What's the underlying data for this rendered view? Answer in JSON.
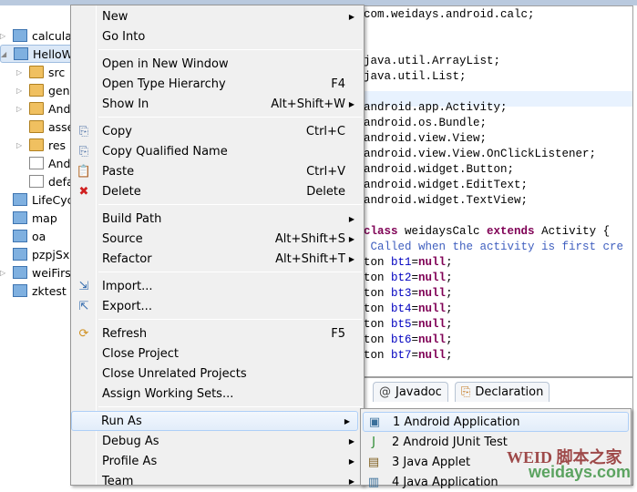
{
  "explorer": {
    "items": [
      {
        "label": "calculat",
        "kind": "proj",
        "tw": true,
        "indent": 0
      },
      {
        "label": "HelloW",
        "kind": "proj",
        "tw": true,
        "indent": 0,
        "selected": true
      },
      {
        "label": "src",
        "kind": "folder",
        "tw": true,
        "indent": 1
      },
      {
        "label": "gen",
        "kind": "folder",
        "tw": true,
        "indent": 1
      },
      {
        "label": "And",
        "kind": "lib",
        "tw": true,
        "indent": 1
      },
      {
        "label": "asse",
        "kind": "folder",
        "tw": false,
        "indent": 1
      },
      {
        "label": "res",
        "kind": "folder",
        "tw": true,
        "indent": 1
      },
      {
        "label": "And",
        "kind": "file",
        "tw": false,
        "indent": 1
      },
      {
        "label": "defa",
        "kind": "file",
        "tw": false,
        "indent": 1
      },
      {
        "label": "LifeCycl",
        "kind": "closed",
        "tw": false,
        "indent": 0
      },
      {
        "label": "map",
        "kind": "closed",
        "tw": false,
        "indent": 0
      },
      {
        "label": "oa",
        "kind": "closed",
        "tw": false,
        "indent": 0
      },
      {
        "label": "pzpjSx",
        "kind": "closed",
        "tw": false,
        "indent": 0
      },
      {
        "label": "weiFirst",
        "kind": "proj",
        "tw": true,
        "indent": 0
      },
      {
        "label": "zktest",
        "kind": "closed",
        "tw": false,
        "indent": 0
      }
    ]
  },
  "editor": {
    "lines": [
      [
        [
          "",
          "com.weidays.android.calc;"
        ]
      ],
      [],
      [],
      [
        [
          "",
          "java.util.ArrayList;"
        ]
      ],
      [
        [
          "",
          "java.util.List;"
        ]
      ],
      [],
      [
        [
          "",
          "android.app.Activity;"
        ]
      ],
      [
        [
          "",
          "android.os.Bundle;"
        ]
      ],
      [
        [
          "",
          "android.view.View;"
        ]
      ],
      [
        [
          "",
          "android.view.View.OnClickListener;"
        ]
      ],
      [
        [
          "",
          "android.widget.Button;"
        ]
      ],
      [
        [
          "",
          "android.widget.EditText;"
        ]
      ],
      [
        [
          "",
          "android.widget.TextView;"
        ]
      ],
      [],
      [
        [
          "kw",
          "class"
        ],
        [
          "",
          " weidaysCalc "
        ],
        [
          "kw",
          "extends"
        ],
        [
          "",
          " Activity {"
        ]
      ],
      [
        [
          "cm",
          " Called when the activity is first cre"
        ]
      ],
      [
        [
          "",
          "ton "
        ],
        [
          "fld",
          "bt1"
        ],
        [
          "",
          "="
        ],
        [
          "kw",
          "null"
        ],
        [
          "",
          ";"
        ]
      ],
      [
        [
          "",
          "ton "
        ],
        [
          "fld",
          "bt2"
        ],
        [
          "",
          "="
        ],
        [
          "kw",
          "null"
        ],
        [
          "",
          ";"
        ]
      ],
      [
        [
          "",
          "ton "
        ],
        [
          "fld",
          "bt3"
        ],
        [
          "",
          "="
        ],
        [
          "kw",
          "null"
        ],
        [
          "",
          ";"
        ]
      ],
      [
        [
          "",
          "ton "
        ],
        [
          "fld",
          "bt4"
        ],
        [
          "",
          "="
        ],
        [
          "kw",
          "null"
        ],
        [
          "",
          ";"
        ]
      ],
      [
        [
          "",
          "ton "
        ],
        [
          "fld",
          "bt5"
        ],
        [
          "",
          "="
        ],
        [
          "kw",
          "null"
        ],
        [
          "",
          ";"
        ]
      ],
      [
        [
          "",
          "ton "
        ],
        [
          "fld",
          "bt6"
        ],
        [
          "",
          "="
        ],
        [
          "kw",
          "null"
        ],
        [
          "",
          ";"
        ]
      ],
      [
        [
          "",
          "ton "
        ],
        [
          "fld",
          "bt7"
        ],
        [
          "",
          "="
        ],
        [
          "kw",
          "null"
        ],
        [
          "",
          ";"
        ]
      ]
    ]
  },
  "bottom": {
    "tabs": [
      {
        "label": "Javadoc",
        "icon": "@"
      },
      {
        "label": "Declaration",
        "icon": "declaration-icon"
      }
    ]
  },
  "menu": {
    "groups": [
      [
        {
          "label": "New",
          "arrow": true
        },
        {
          "label": "Go Into"
        }
      ],
      [
        {
          "label": "Open in New Window"
        },
        {
          "label": "Open Type Hierarchy",
          "shortcut": "F4"
        },
        {
          "label": "Show In",
          "shortcut": "Alt+Shift+W",
          "arrow": true
        }
      ],
      [
        {
          "label": "Copy",
          "shortcut": "Ctrl+C",
          "icon": "copy-icon"
        },
        {
          "label": "Copy Qualified Name",
          "icon": "copy-qualified-icon"
        },
        {
          "label": "Paste",
          "shortcut": "Ctrl+V",
          "icon": "paste-icon"
        },
        {
          "label": "Delete",
          "shortcut": "Delete",
          "icon": "delete-icon"
        }
      ],
      [
        {
          "label": "Build Path",
          "arrow": true
        },
        {
          "label": "Source",
          "shortcut": "Alt+Shift+S",
          "arrow": true
        },
        {
          "label": "Refactor",
          "shortcut": "Alt+Shift+T",
          "arrow": true
        }
      ],
      [
        {
          "label": "Import...",
          "icon": "import-icon"
        },
        {
          "label": "Export...",
          "icon": "export-icon"
        }
      ],
      [
        {
          "label": "Refresh",
          "shortcut": "F5",
          "icon": "refresh-icon"
        },
        {
          "label": "Close Project"
        },
        {
          "label": "Close Unrelated Projects"
        },
        {
          "label": "Assign Working Sets..."
        }
      ],
      [
        {
          "label": "Run As",
          "arrow": true,
          "hover": true
        },
        {
          "label": "Debug As",
          "arrow": true
        },
        {
          "label": "Profile As",
          "arrow": true
        },
        {
          "label": "Team",
          "arrow": true
        }
      ]
    ]
  },
  "submenu": {
    "items": [
      {
        "label": "1 Android Application",
        "icon": "android-app-icon",
        "hover": true
      },
      {
        "label": "2 Android JUnit Test",
        "icon": "junit-icon"
      },
      {
        "label": "3 Java Applet",
        "icon": "applet-icon"
      },
      {
        "label": "4 Java Application",
        "icon": "java-app-icon"
      }
    ]
  },
  "watermark": {
    "text1": "WEID 脚本之家",
    "text2": "weidays.com"
  },
  "colors": {
    "keyword": "#7f0055",
    "field": "#0000c0",
    "comment": "#3f5fbf",
    "menu_bg": "#f0f0f0",
    "hover_border": "#aecff7"
  }
}
